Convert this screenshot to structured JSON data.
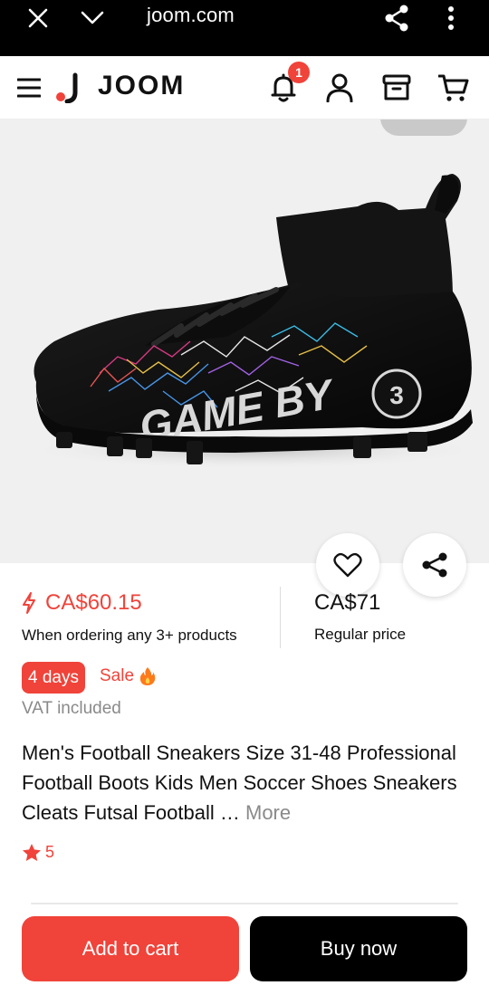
{
  "browser": {
    "url": "joom.com",
    "icons": [
      "close-icon",
      "chevron-down-icon",
      "share-icon",
      "more-vert-icon"
    ]
  },
  "header": {
    "logo": "JOOM",
    "notification_count": "1",
    "icons": [
      "menu-icon",
      "bell-icon",
      "profile-icon",
      "orders-icon",
      "cart-icon"
    ]
  },
  "product": {
    "image_alt": "black football boot",
    "boot_text": "GAME BY",
    "boot_number": "3"
  },
  "price": {
    "discounted": "CA$60.15",
    "discount_note": "When ordering any 3+ products",
    "regular": "CA$71",
    "regular_label": "Regular price"
  },
  "promo": {
    "days": "4 days",
    "sale": "Sale",
    "vat": "VAT included"
  },
  "title": {
    "text": "Men's Football Sneakers Size 31-48 Professional Football Boots Kids Men Soccer Shoes Sneakers Cleats Futsal Football …",
    "more": "More"
  },
  "rating": {
    "value": "5"
  },
  "actions": {
    "add_to_cart": "Add to cart",
    "buy_now": "Buy now"
  },
  "colors": {
    "accent": "#f0433a",
    "black": "#000000"
  }
}
